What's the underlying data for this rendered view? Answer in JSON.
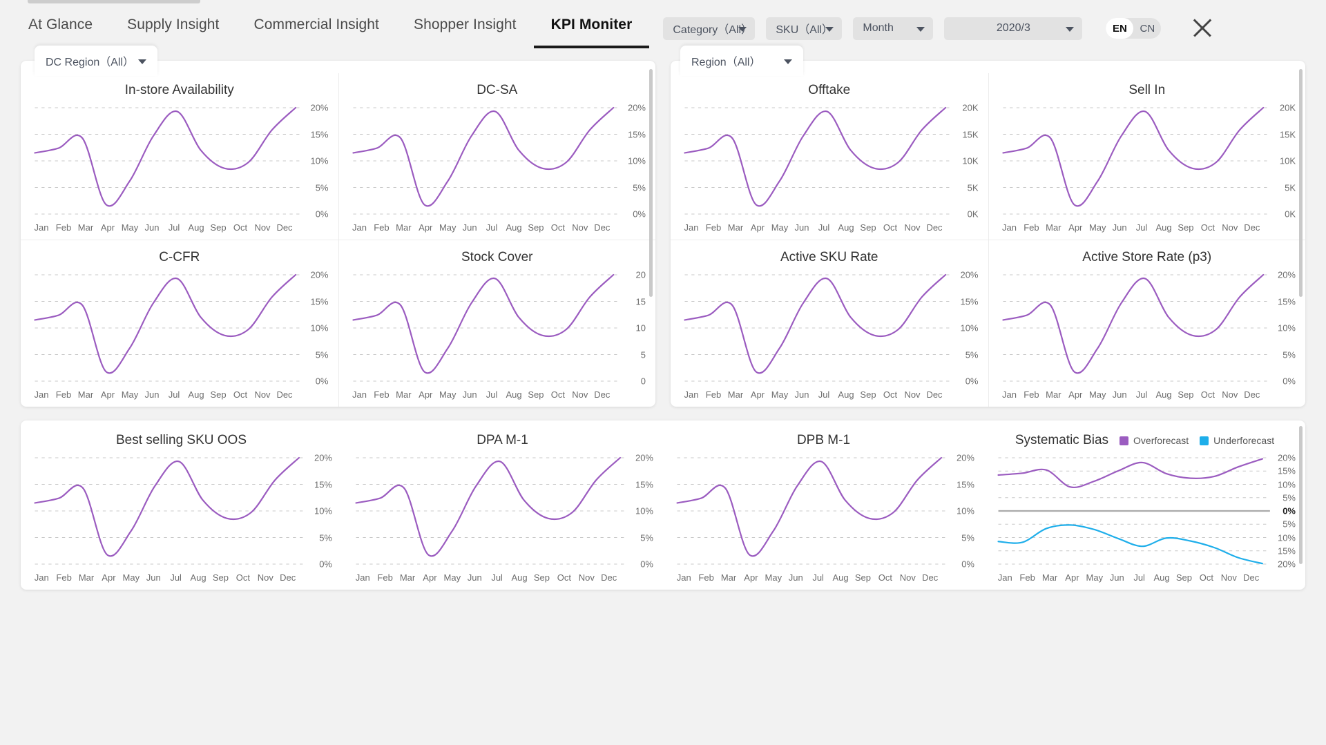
{
  "nav": {
    "items": [
      {
        "label": "At Glance",
        "active": false
      },
      {
        "label": "Supply Insight",
        "active": false
      },
      {
        "label": "Commercial Insight",
        "active": false
      },
      {
        "label": "Shopper Insight",
        "active": false
      },
      {
        "label": "KPI Moniter",
        "active": true
      }
    ]
  },
  "filters": {
    "category": "Category（All）",
    "sku": "SKU（All）",
    "period": "Month",
    "year_month": "2020/3",
    "lang_en": "EN",
    "lang_cn": "CN",
    "close_icon": "close-icon"
  },
  "panels": {
    "left_filter": "DC Region（All）",
    "right_filter": "Region（All）"
  },
  "months": [
    "Jan",
    "Feb",
    "Mar",
    "Apr",
    "May",
    "Jun",
    "Jul",
    "Aug",
    "Sep",
    "Oct",
    "Nov",
    "Dec"
  ],
  "axis_percent": [
    "20%",
    "15%",
    "10%",
    "5%",
    "0%"
  ],
  "axis_thousand": [
    "20K",
    "15K",
    "10K",
    "5K",
    "0K"
  ],
  "axis_plain": [
    "20",
    "15",
    "10",
    "5",
    "0"
  ],
  "axis_bias": [
    "20%",
    "15%",
    "10%",
    "5%",
    "0%",
    "5%",
    "10%",
    "15%",
    "20%"
  ],
  "legend": {
    "overforecast": "Overforecast",
    "underforecast": "Underforecast",
    "over_color": "#9b59c6",
    "under_color": "#1eaeea"
  },
  "colors": {
    "line": "#9b5cc0",
    "under_line": "#1eaeea",
    "zero_line": "#aaaaaa",
    "grid": "#c8c8c8"
  },
  "chart_data": [
    {
      "type": "line",
      "title": "In-store Availability",
      "xlabel": "",
      "ylabel": "",
      "x": [
        "Jan",
        "Feb",
        "Mar",
        "Apr",
        "May",
        "Jun",
        "Jul",
        "Aug",
        "Sep",
        "Oct",
        "Nov",
        "Dec"
      ],
      "ylim": [
        0,
        20
      ],
      "yticks": [
        0,
        5,
        10,
        15,
        20
      ],
      "ytick_labels": [
        "0%",
        "5%",
        "10%",
        "15%",
        "20%"
      ],
      "grid": true,
      "legend": "none",
      "series": [
        {
          "name": "value",
          "color": "#9b5cc0",
          "values": [
            11.5,
            12.4,
            14.3,
            1.8,
            6.2,
            14.7,
            19.3,
            12.0,
            8.6,
            9.7,
            15.8,
            20.0
          ]
        }
      ]
    },
    {
      "type": "line",
      "title": "DC-SA",
      "x": [
        "Jan",
        "Feb",
        "Mar",
        "Apr",
        "May",
        "Jun",
        "Jul",
        "Aug",
        "Sep",
        "Oct",
        "Nov",
        "Dec"
      ],
      "ylim": [
        0,
        20
      ],
      "yticks": [
        0,
        5,
        10,
        15,
        20
      ],
      "ytick_labels": [
        "0%",
        "5%",
        "10%",
        "15%",
        "20%"
      ],
      "grid": true,
      "legend": "none",
      "series": [
        {
          "name": "value",
          "color": "#9b5cc0",
          "values": [
            11.5,
            12.4,
            14.3,
            1.8,
            6.2,
            14.7,
            19.3,
            12.0,
            8.6,
            9.7,
            15.8,
            20.0
          ]
        }
      ]
    },
    {
      "type": "line",
      "title": "C-CFR",
      "x": [
        "Jan",
        "Feb",
        "Mar",
        "Apr",
        "May",
        "Jun",
        "Jul",
        "Aug",
        "Sep",
        "Oct",
        "Nov",
        "Dec"
      ],
      "ylim": [
        0,
        20
      ],
      "yticks": [
        0,
        5,
        10,
        15,
        20
      ],
      "ytick_labels": [
        "0%",
        "5%",
        "10%",
        "15%",
        "20%"
      ],
      "grid": true,
      "legend": "none",
      "series": [
        {
          "name": "value",
          "color": "#9b5cc0",
          "values": [
            11.5,
            12.4,
            14.3,
            1.8,
            6.2,
            14.7,
            19.3,
            12.0,
            8.6,
            9.7,
            15.8,
            20.0
          ]
        }
      ]
    },
    {
      "type": "line",
      "title": "Stock Cover",
      "x": [
        "Jan",
        "Feb",
        "Mar",
        "Apr",
        "May",
        "Jun",
        "Jul",
        "Aug",
        "Sep",
        "Oct",
        "Nov",
        "Dec"
      ],
      "ylim": [
        0,
        20
      ],
      "yticks": [
        0,
        5,
        10,
        15,
        20
      ],
      "ytick_labels": [
        "0",
        "5",
        "10",
        "15",
        "20"
      ],
      "grid": true,
      "legend": "none",
      "series": [
        {
          "name": "value",
          "color": "#9b5cc0",
          "values": [
            11.5,
            12.4,
            14.3,
            1.8,
            6.2,
            14.7,
            19.3,
            12.0,
            8.6,
            9.7,
            15.8,
            20.0
          ]
        }
      ]
    },
    {
      "type": "line",
      "title": "Offtake",
      "x": [
        "Jan",
        "Feb",
        "Mar",
        "Apr",
        "May",
        "Jun",
        "Jul",
        "Aug",
        "Sep",
        "Oct",
        "Nov",
        "Dec"
      ],
      "ylim": [
        0,
        20000
      ],
      "yticks": [
        0,
        5000,
        10000,
        15000,
        20000
      ],
      "ytick_labels": [
        "0K",
        "5K",
        "10K",
        "15K",
        "20K"
      ],
      "grid": true,
      "legend": "none",
      "series": [
        {
          "name": "value",
          "color": "#9b5cc0",
          "values": [
            11500,
            12400,
            14300,
            1800,
            6200,
            14700,
            19300,
            12000,
            8600,
            9700,
            15800,
            20000
          ]
        }
      ]
    },
    {
      "type": "line",
      "title": "Sell In",
      "x": [
        "Jan",
        "Feb",
        "Mar",
        "Apr",
        "May",
        "Jun",
        "Jul",
        "Aug",
        "Sep",
        "Oct",
        "Nov",
        "Dec"
      ],
      "ylim": [
        0,
        20000
      ],
      "yticks": [
        0,
        5000,
        10000,
        15000,
        20000
      ],
      "ytick_labels": [
        "0K",
        "5K",
        "10K",
        "15K",
        "20K"
      ],
      "grid": true,
      "legend": "none",
      "series": [
        {
          "name": "value",
          "color": "#9b5cc0",
          "values": [
            11500,
            12400,
            14300,
            1800,
            6200,
            14700,
            19300,
            12000,
            8600,
            9700,
            15800,
            20000
          ]
        }
      ]
    },
    {
      "type": "line",
      "title": "Active SKU Rate",
      "x": [
        "Jan",
        "Feb",
        "Mar",
        "Apr",
        "May",
        "Jun",
        "Jul",
        "Aug",
        "Sep",
        "Oct",
        "Nov",
        "Dec"
      ],
      "ylim": [
        0,
        20
      ],
      "yticks": [
        0,
        5,
        10,
        15,
        20
      ],
      "ytick_labels": [
        "0%",
        "5%",
        "10%",
        "15%",
        "20%"
      ],
      "grid": true,
      "legend": "none",
      "series": [
        {
          "name": "value",
          "color": "#9b5cc0",
          "values": [
            11.5,
            12.4,
            14.3,
            1.8,
            6.2,
            14.7,
            19.3,
            12.0,
            8.6,
            9.7,
            15.8,
            20.0
          ]
        }
      ]
    },
    {
      "type": "line",
      "title": "Active Store Rate (p3)",
      "x": [
        "Jan",
        "Feb",
        "Mar",
        "Apr",
        "May",
        "Jun",
        "Jul",
        "Aug",
        "Sep",
        "Oct",
        "Nov",
        "Dec"
      ],
      "ylim": [
        0,
        20
      ],
      "yticks": [
        0,
        5,
        10,
        15,
        20
      ],
      "ytick_labels": [
        "0%",
        "5%",
        "10%",
        "15%",
        "20%"
      ],
      "grid": true,
      "legend": "none",
      "series": [
        {
          "name": "value",
          "color": "#9b5cc0",
          "values": [
            11.5,
            12.4,
            14.3,
            1.8,
            6.2,
            14.7,
            19.3,
            12.0,
            8.6,
            9.7,
            15.8,
            20.0
          ]
        }
      ]
    },
    {
      "type": "line",
      "title": "Best selling SKU OOS",
      "x": [
        "Jan",
        "Feb",
        "Mar",
        "Apr",
        "May",
        "Jun",
        "Jul",
        "Aug",
        "Sep",
        "Oct",
        "Nov",
        "Dec"
      ],
      "ylim": [
        0,
        20
      ],
      "yticks": [
        0,
        5,
        10,
        15,
        20
      ],
      "ytick_labels": [
        "0%",
        "5%",
        "10%",
        "15%",
        "20%"
      ],
      "grid": true,
      "legend": "none",
      "series": [
        {
          "name": "value",
          "color": "#9b5cc0",
          "values": [
            11.5,
            12.4,
            14.3,
            1.8,
            6.2,
            14.7,
            19.3,
            12.0,
            8.6,
            9.7,
            15.8,
            20.0
          ]
        }
      ]
    },
    {
      "type": "line",
      "title": "DPA M-1",
      "x": [
        "Jan",
        "Feb",
        "Mar",
        "Apr",
        "May",
        "Jun",
        "Jul",
        "Aug",
        "Sep",
        "Oct",
        "Nov",
        "Dec"
      ],
      "ylim": [
        0,
        20
      ],
      "yticks": [
        0,
        5,
        10,
        15,
        20
      ],
      "ytick_labels": [
        "0%",
        "5%",
        "10%",
        "15%",
        "20%"
      ],
      "grid": true,
      "legend": "none",
      "series": [
        {
          "name": "value",
          "color": "#9b5cc0",
          "values": [
            11.5,
            12.4,
            14.3,
            1.8,
            6.2,
            14.7,
            19.3,
            12.0,
            8.6,
            9.7,
            15.8,
            20.0
          ]
        }
      ]
    },
    {
      "type": "line",
      "title": "DPB M-1",
      "x": [
        "Jan",
        "Feb",
        "Mar",
        "Apr",
        "May",
        "Jun",
        "Jul",
        "Aug",
        "Sep",
        "Oct",
        "Nov",
        "Dec"
      ],
      "ylim": [
        0,
        20
      ],
      "yticks": [
        0,
        5,
        10,
        15,
        20
      ],
      "ytick_labels": [
        "0%",
        "5%",
        "10%",
        "15%",
        "20%"
      ],
      "grid": true,
      "legend": "none",
      "series": [
        {
          "name": "value",
          "color": "#9b5cc0",
          "values": [
            11.5,
            12.4,
            14.3,
            1.8,
            6.2,
            14.7,
            19.3,
            12.0,
            8.6,
            9.7,
            15.8,
            20.0
          ]
        }
      ]
    },
    {
      "type": "line",
      "title": "Systematic Bias",
      "x": [
        "Jan",
        "Feb",
        "Mar",
        "Apr",
        "May",
        "Jun",
        "Jul",
        "Aug",
        "Sep",
        "Oct",
        "Nov",
        "Dec"
      ],
      "ylim": [
        -20,
        20
      ],
      "yticks": [
        20,
        15,
        10,
        5,
        0,
        -5,
        -10,
        -15,
        -20
      ],
      "ytick_labels": [
        "20%",
        "15%",
        "10%",
        "5%",
        "0%",
        "5%",
        "10%",
        "15%",
        "20%"
      ],
      "grid": true,
      "legend": "top-right",
      "series": [
        {
          "name": "Overforecast",
          "color": "#9b5cc0",
          "values": [
            13.5,
            14.2,
            15.4,
            9.0,
            11.2,
            15.1,
            18.2,
            14.0,
            12.3,
            13.0,
            16.6,
            19.6
          ]
        },
        {
          "name": "Underforecast",
          "color": "#1eaeea",
          "values": [
            -11.5,
            -11.8,
            -6.6,
            -5.3,
            -7.0,
            -10.4,
            -13.3,
            -10.2,
            -11.3,
            -13.8,
            -17.6,
            -19.8
          ]
        }
      ]
    }
  ]
}
